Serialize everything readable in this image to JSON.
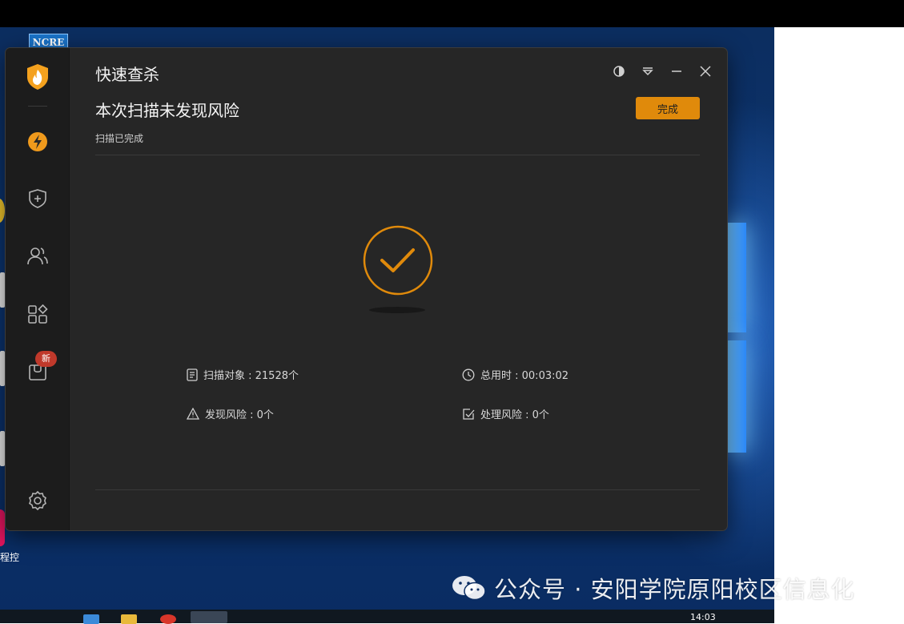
{
  "app": {
    "title": "快速查杀",
    "result_title": "本次扫描未发现风险",
    "result_subtitle": "扫描已完成",
    "done_label": "完成",
    "badge": "新"
  },
  "stats": {
    "scan_objects": "扫描对象 : 21528个",
    "total_time": "总用时 : 00:03:02",
    "risks_found": "发现风险 : 0个",
    "risks_handled": "处理风险 : 0个"
  },
  "desktop": {
    "ncre_label": "NCRE",
    "edge_label": "程控",
    "watermark": "公众号 · 安阳学院原阳校区信息化",
    "taskbar_time": "14:03"
  },
  "colors": {
    "accent": "#e08a0b",
    "window_bg": "#262626",
    "sidebar_bg": "#1c1c1c",
    "badge": "#c0392b"
  }
}
